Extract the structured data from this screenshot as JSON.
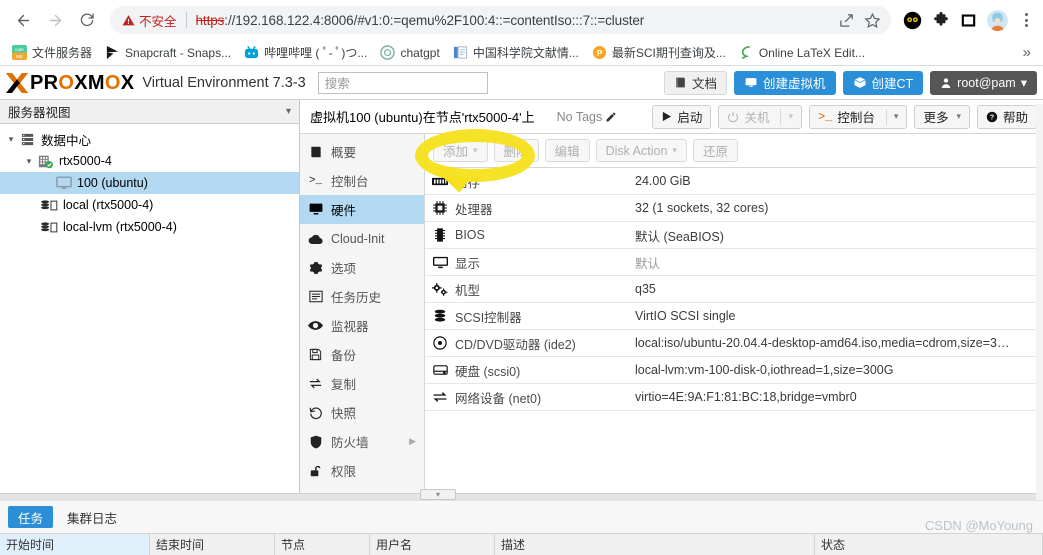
{
  "browser": {
    "nav": {
      "back": "back-arrow",
      "forward": "forward-arrow",
      "reload": "reload"
    },
    "security_label": "不安全",
    "url_scheme": "https",
    "url_rest": "://192.168.122.4:8006/#v1:0:=qemu%2F100:4::=contentIso:::7::=cluster",
    "url_full": "https://192.168.122.4:8006/#v1:0:=qemu%2F100:4::=contentIso:::7::=cluster",
    "bookmarks": [
      {
        "label": "文件服务器",
        "icon": "cute-me-icon"
      },
      {
        "label": "Snapcraft - Snaps...",
        "icon": "snapcraft-icon"
      },
      {
        "label": "哔哩哔哩 ( ﾟ- ﾟ)つ...",
        "icon": "bilibili-icon"
      },
      {
        "label": "chatgpt",
        "icon": "openai-icon"
      },
      {
        "label": "中国科学院文献情...",
        "icon": "document-icon"
      },
      {
        "label": "最新SCI期刊查询及...",
        "icon": "letter-p-icon"
      },
      {
        "label": "Online LaTeX Edit...",
        "icon": "overleaf-icon"
      }
    ],
    "bookmarks_overflow": "»"
  },
  "pve_header": {
    "logo_word_1": "PR",
    "logo_word_o": "O",
    "logo_word_2": "XM",
    "logo_word_o2": "O",
    "logo_word_3": "X",
    "product": "Virtual Environment 7.3-3",
    "search_placeholder": "搜索",
    "docs_label": "文档",
    "create_vm_label": "创建虚拟机",
    "create_ct_label": "创建CT",
    "user_label": "root@pam"
  },
  "tree": {
    "header": "服务器视图",
    "nodes": [
      {
        "label": "数据中心",
        "icon": "datacenter-icon",
        "depth": 0,
        "arrow": "▾",
        "selected": false
      },
      {
        "label": "rtx5000-4",
        "icon": "node-online-icon",
        "depth": 1,
        "arrow": "▾",
        "selected": false
      },
      {
        "label": "100 (ubuntu)",
        "icon": "vm-icon",
        "depth": 2,
        "arrow": "",
        "selected": true
      },
      {
        "label": "local (rtx5000-4)",
        "icon": "storage-icon",
        "depth": 2,
        "arrow": "",
        "selected": false
      },
      {
        "label": "local-lvm (rtx5000-4)",
        "icon": "storage-icon",
        "depth": 2,
        "arrow": "",
        "selected": false
      }
    ]
  },
  "vm_panel": {
    "title": "虚拟机100 (ubuntu)在节点'rtx5000-4'上",
    "tags_label": "No Tags",
    "actions": [
      {
        "label": "启动",
        "icon": "play-icon",
        "disabled": false,
        "has_dropdown": false
      },
      {
        "label": "关机",
        "icon": "power-icon",
        "disabled": true,
        "has_dropdown": true
      },
      {
        "label": "控制台",
        "icon": "console-icon",
        "disabled": false,
        "has_dropdown": true
      },
      {
        "label": "更多",
        "icon": "",
        "disabled": false,
        "has_dropdown": true
      },
      {
        "label": "帮助",
        "icon": "help-icon",
        "disabled": false,
        "has_dropdown": false
      }
    ],
    "nav": [
      {
        "label": "概要",
        "icon": "summary-icon",
        "active": false,
        "submenu": false
      },
      {
        "label": "控制台",
        "icon": "console-icon",
        "active": false,
        "submenu": false
      },
      {
        "label": "硬件",
        "icon": "hardware-monitor-icon",
        "active": true,
        "submenu": false
      },
      {
        "label": "Cloud-Init",
        "icon": "cloud-icon",
        "active": false,
        "submenu": false
      },
      {
        "label": "选项",
        "icon": "gear-icon",
        "active": false,
        "submenu": false
      },
      {
        "label": "任务历史",
        "icon": "list-icon",
        "active": false,
        "submenu": false
      },
      {
        "label": "监视器",
        "icon": "eye-icon",
        "active": false,
        "submenu": false
      },
      {
        "label": "备份",
        "icon": "save-icon",
        "active": false,
        "submenu": false
      },
      {
        "label": "复制",
        "icon": "replicate-icon",
        "active": false,
        "submenu": false
      },
      {
        "label": "快照",
        "icon": "history-icon",
        "active": false,
        "submenu": false
      },
      {
        "label": "防火墙",
        "icon": "shield-icon",
        "active": false,
        "submenu": true
      },
      {
        "label": "权限",
        "icon": "unlock-icon",
        "active": false,
        "submenu": false
      }
    ],
    "toolbar": [
      {
        "label": "添加",
        "has_dropdown": true
      },
      {
        "label": "删除",
        "has_dropdown": false
      },
      {
        "label": "编辑",
        "has_dropdown": false
      },
      {
        "label": "Disk Action",
        "has_dropdown": true
      },
      {
        "label": "还原",
        "has_dropdown": false
      }
    ],
    "hardware": [
      {
        "icon": "memory-icon",
        "key": "内存",
        "value": "24.00 GiB",
        "muted": false
      },
      {
        "icon": "cpu-icon",
        "key": "处理器",
        "value": "32 (1 sockets, 32 cores)",
        "muted": false
      },
      {
        "icon": "bios-icon",
        "key": "BIOS",
        "value": "默认 (SeaBIOS)",
        "muted": false
      },
      {
        "icon": "display-icon",
        "key": "显示",
        "value": "默认",
        "muted": true
      },
      {
        "icon": "machine-icon",
        "key": "机型",
        "value": "q35",
        "muted": false
      },
      {
        "icon": "scsi-icon",
        "key": "SCSI控制器",
        "value": "VirtIO SCSI single",
        "muted": false
      },
      {
        "icon": "cdrom-icon",
        "key": "CD/DVD驱动器 (ide2)",
        "value": "local:iso/ubuntu-20.04.4-desktop-amd64.iso,media=cdrom,size=3…",
        "muted": false
      },
      {
        "icon": "harddisk-icon",
        "key": "硬盘 (scsi0)",
        "value": "local-lvm:vm-100-disk-0,iothread=1,size=300G",
        "muted": false
      },
      {
        "icon": "network-icon",
        "key": "网络设备 (net0)",
        "value": "virtio=4E:9A:F1:81:BC:18,bridge=vmbr0",
        "muted": false
      }
    ]
  },
  "bottom": {
    "tabs": [
      {
        "label": "任务",
        "active": true
      },
      {
        "label": "集群日志",
        "active": false
      }
    ],
    "columns": [
      "开始时间",
      "结束时间",
      "节点",
      "用户名",
      "描述",
      "状态"
    ]
  },
  "annotation": {
    "watermark": "CSDN @MoYoung",
    "highlight_target": "添加"
  },
  "colors": {
    "accent_blue": "#2a8fd6",
    "select_blue": "#b3d9f2",
    "brand_orange": "#e57000",
    "warning_red": "#c5221f",
    "highlight_yellow": "#f5e01a"
  }
}
